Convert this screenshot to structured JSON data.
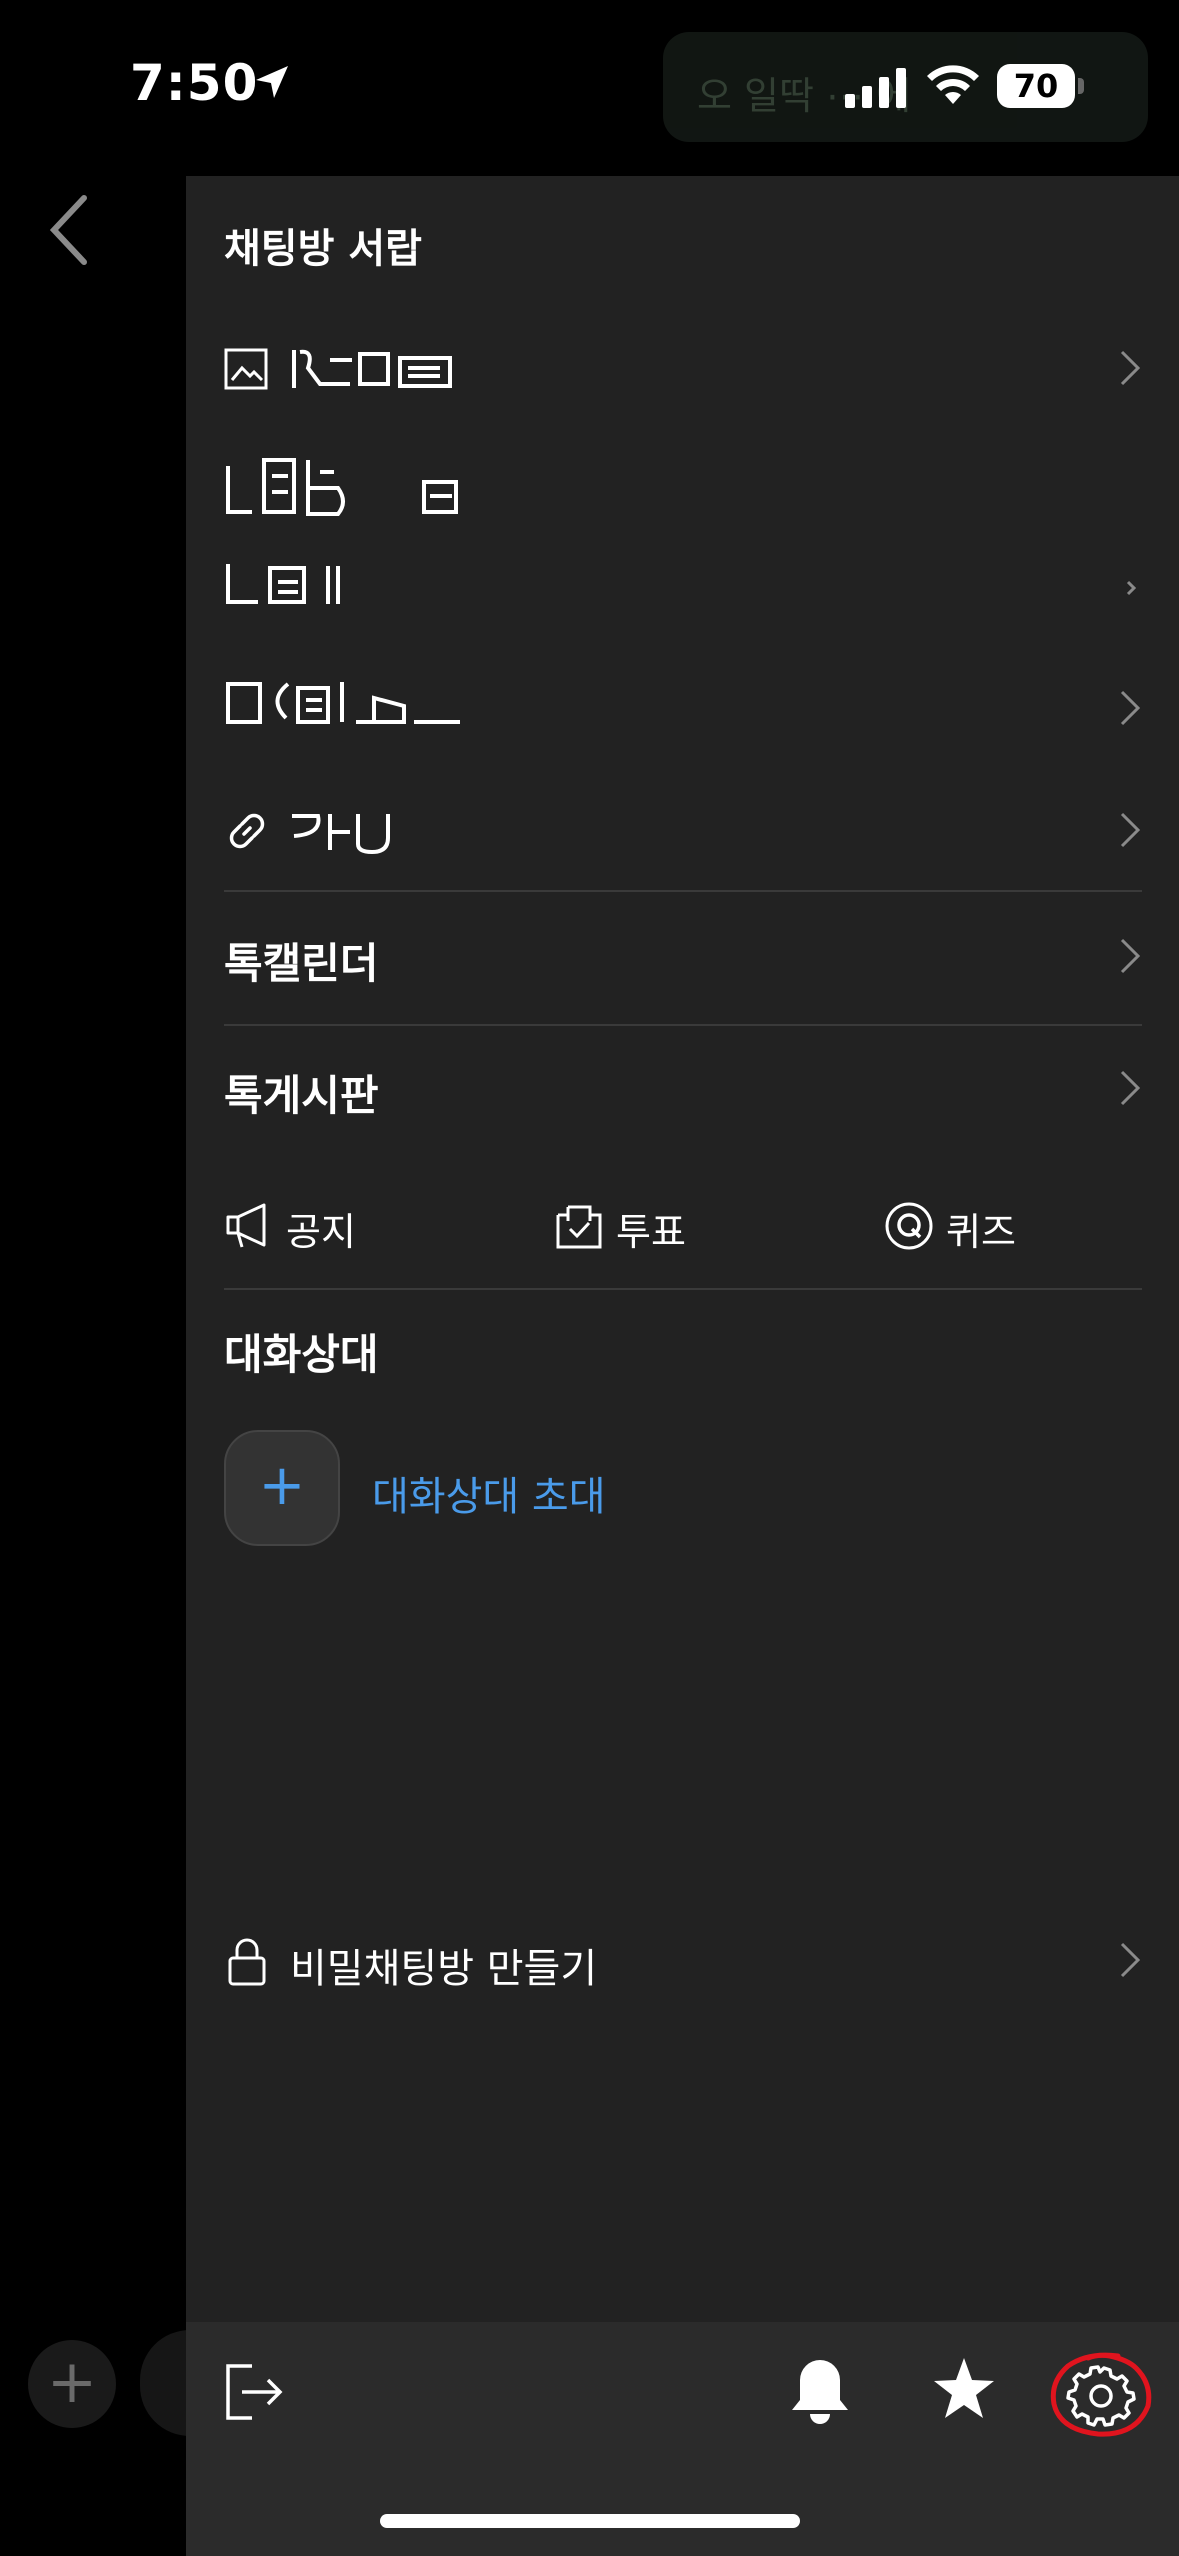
{
  "status_bar": {
    "time": "7:50",
    "battery": "70"
  },
  "background_chat": {
    "bubble_text": "오 일딱 ⋯ 에"
  },
  "drawer": {
    "title": "채팅방 서랍",
    "sections": {
      "calendar": "톡캘린더",
      "board": "톡게시판"
    },
    "tools": [
      {
        "label": "공지",
        "icon": "megaphone-icon"
      },
      {
        "label": "투표",
        "icon": "vote-box-icon"
      },
      {
        "label": "퀴즈",
        "icon": "quiz-q-icon"
      }
    ],
    "members": {
      "title": "대화상대",
      "invite_label": "대화상대 초대",
      "invite_icon": "+"
    },
    "secret_chat": "비밀채팅방 만들기",
    "bottom_icons": [
      "exit-icon",
      "bell-icon",
      "star-icon",
      "gear-icon"
    ]
  },
  "colors": {
    "drawer_bg": "#222222",
    "accent_blue": "#4a9bea",
    "annotation_red": "#e0141e"
  }
}
